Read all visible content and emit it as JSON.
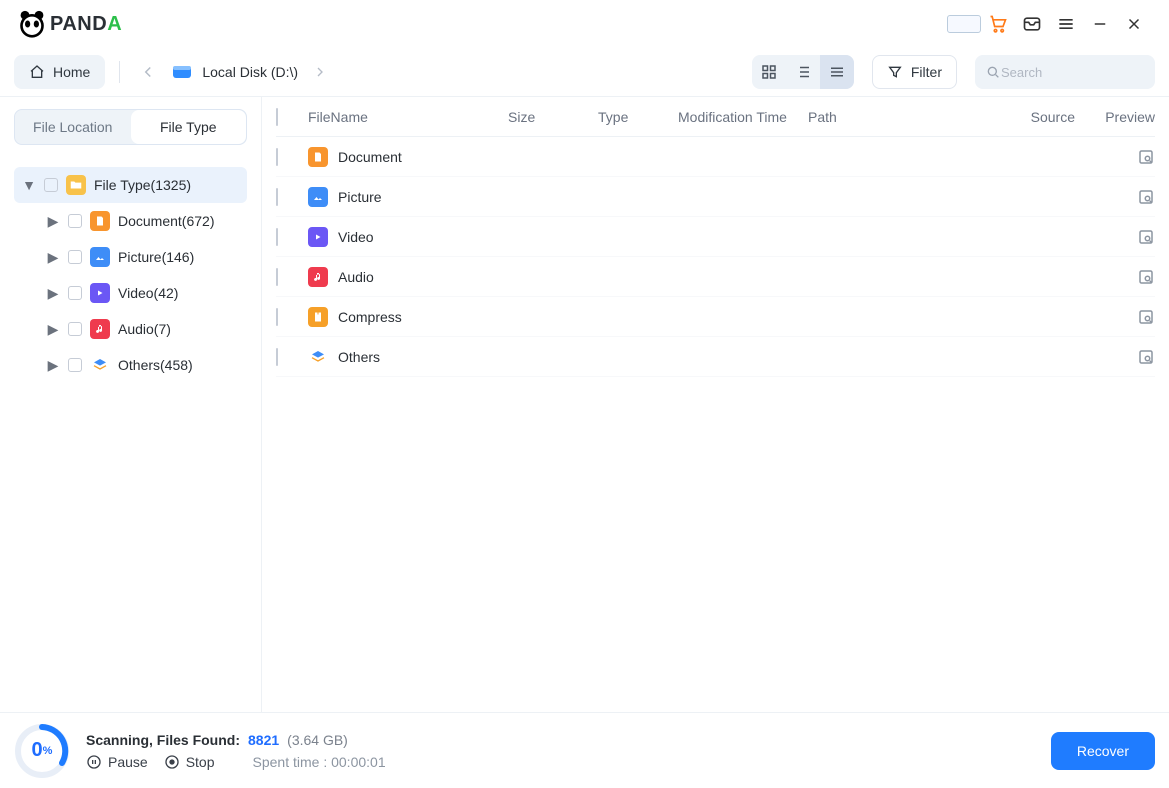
{
  "app": {
    "brand": "PANDA"
  },
  "titlebar": {},
  "toolbar": {
    "home_label": "Home",
    "breadcrumb_disk": "Local Disk (D:\\)",
    "filter_label": "Filter",
    "search_placeholder": "Search"
  },
  "sidebar": {
    "tab_location_label": "File Location",
    "tab_type_label": "File Type",
    "root_label": "File Type(1325)",
    "items": [
      {
        "label": "Document(672)",
        "icon": "doc"
      },
      {
        "label": "Picture(146)",
        "icon": "pic"
      },
      {
        "label": "Video(42)",
        "icon": "vid"
      },
      {
        "label": "Audio(7)",
        "icon": "aud"
      },
      {
        "label": "Others(458)",
        "icon": "oth"
      }
    ]
  },
  "table": {
    "headers": {
      "name": "FileName",
      "size": "Size",
      "type": "Type",
      "mtime": "Modification Time",
      "path": "Path",
      "source": "Source",
      "preview": "Preview"
    },
    "rows": [
      {
        "name": "Document",
        "icon": "doc"
      },
      {
        "name": "Picture",
        "icon": "pic"
      },
      {
        "name": "Video",
        "icon": "vid"
      },
      {
        "name": "Audio",
        "icon": "aud"
      },
      {
        "name": "Compress",
        "icon": "zip"
      },
      {
        "name": "Others",
        "icon": "oth"
      }
    ]
  },
  "footer": {
    "progress_pct": "0",
    "progress_unit": "%",
    "status_label": "Scanning, Files Found:",
    "found_count": "8821",
    "found_size": "(3.64 GB)",
    "pause_label": "Pause",
    "stop_label": "Stop",
    "spent_label": "Spent time : 00:00:01",
    "recover_label": "Recover"
  }
}
